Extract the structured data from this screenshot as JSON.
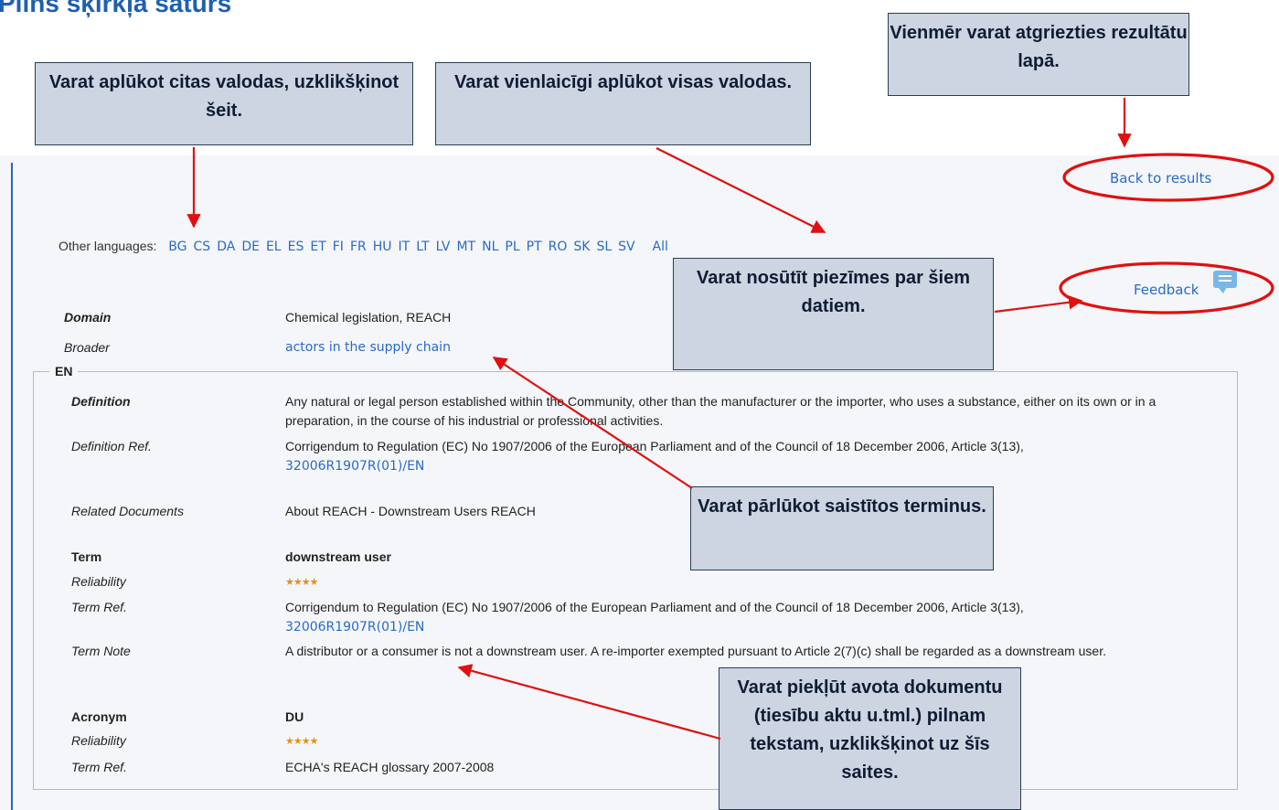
{
  "slide_title": "Pilns šķirkļa saturs",
  "back_to_results": "Back to results",
  "other_languages": {
    "label": "Other languages:",
    "languages": [
      "BG",
      "CS",
      "DA",
      "DE",
      "EL",
      "ES",
      "ET",
      "FI",
      "FR",
      "HU",
      "IT",
      "LT",
      "LV",
      "MT",
      "NL",
      "PL",
      "PT",
      "RO",
      "SK",
      "SL",
      "SV"
    ],
    "all": "All"
  },
  "feedback": "Feedback",
  "domain": {
    "label": "Domain",
    "value": "Chemical legislation, REACH"
  },
  "broader": {
    "label": "Broader",
    "value": "actors in the supply chain"
  },
  "en": {
    "legend": "EN",
    "definition_label": "Definition",
    "definition": "Any natural or legal person established within the Community, other than the manufacturer or the importer, who uses a substance, either on its own or in a preparation, in the course of his industrial or professional activities.",
    "definition_ref_label": "Definition Ref.",
    "definition_ref_text": "Corrigendum to Regulation (EC) No 1907/2006 of the European Parliament and of the Council of 18 December 2006, Article 3(13),",
    "definition_ref_link": "32006R1907R(01)/EN",
    "related_docs_label": "Related Documents",
    "related_docs": "About REACH - Downstream Users REACH",
    "term_label": "Term",
    "term": "downstream user",
    "reliability_label": "Reliability",
    "reliability_stars": "★★★★",
    "term_ref_label": "Term Ref.",
    "term_ref_text": "Corrigendum to Regulation (EC) No 1907/2006 of the European Parliament and of the Council of 18 December 2006, Article 3(13),",
    "term_ref_link": "32006R1907R(01)/EN",
    "term_note_label": "Term Note",
    "term_note": "A distributor or a consumer is not a downstream user. A re-importer exempted pursuant to Article 2(7)(c) shall be regarded as a downstream user.",
    "acronym_label": "Acronym",
    "acronym": "DU",
    "acronym_reliability_label": "Reliability",
    "acronym_reliability_stars": "★★★★",
    "acronym_term_ref_label": "Term Ref.",
    "acronym_term_ref": "ECHA's REACH glossary 2007-2008"
  },
  "callouts": {
    "back": "Vienmēr varat atgriezties rezultātu lapā.",
    "languages": "Varat aplūkot citas valodas, uzklikšķinot šeit.",
    "all": "Varat vienlaicīgi aplūkot visas valodas.",
    "feedback": "Varat nosūtīt piezīmes par šiem datiem.",
    "related": "Varat pārlūkot saistītos terminus.",
    "source": "Varat piekļūt avota dokumentu (tiesību aktu u.tml.) pilnam tekstam, uzklikšķinot uz šīs saites."
  },
  "colors": {
    "link": "#2a6ac6",
    "callout_bg": "#ccd5e1",
    "arrow": "#e01010",
    "title": "#1f5fb0",
    "stars": "#e2911c"
  }
}
